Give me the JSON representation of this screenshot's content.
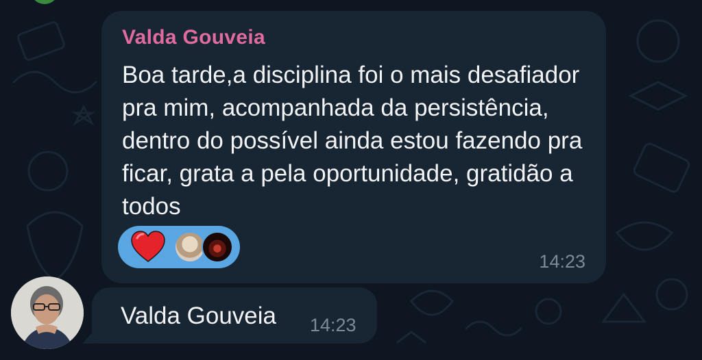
{
  "chat": {
    "messages": [
      {
        "sender": "Valda Gouveia",
        "text": "Boa tarde,a disciplina foi o mais desafiador pra mim, acompanhada da persistência, dentro do possível ainda estou fazendo pra ficar, grata a pela oportunidade, gratidão a todos",
        "time": "14:23",
        "reaction": {
          "emoji": "heart-icon",
          "count_avatars": 2
        }
      },
      {
        "text": "Valda Gouveia",
        "time": "14:23"
      }
    ]
  },
  "colors": {
    "background": "#0e1621",
    "bubble": "#182533",
    "sender_name": "#e06c9f",
    "reaction_pill": "#5aa6e2",
    "timestamp": "#7d8b99"
  }
}
